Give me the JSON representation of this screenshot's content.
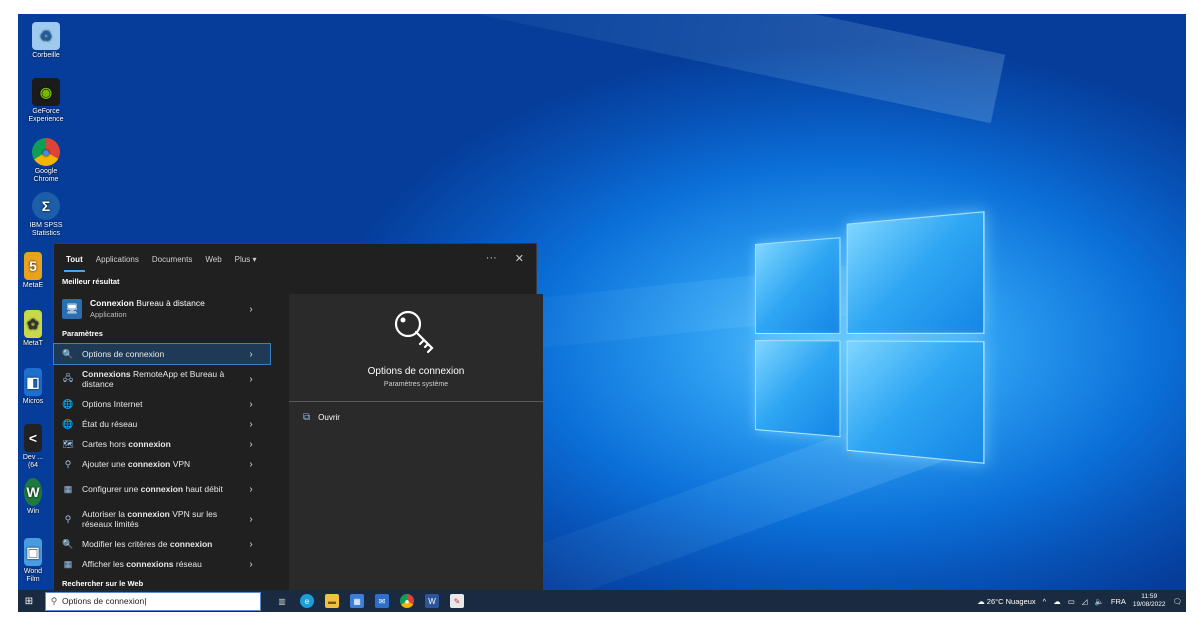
{
  "desktop": {
    "icons": [
      {
        "label": "Corbeille",
        "name": "recycle-bin-icon"
      },
      {
        "label": "GeForce Experience",
        "name": "geforce-icon"
      },
      {
        "label": "Google Chrome",
        "name": "chrome-icon"
      },
      {
        "label": "IBM SPSS Statistics",
        "name": "spss-icon"
      },
      {
        "label": "MetaE",
        "name": "meta-icon"
      },
      {
        "label": "MetaT",
        "name": "metat-icon"
      },
      {
        "label": "Micros",
        "name": "microsoft-icon"
      },
      {
        "label": "Dev ... (64",
        "name": "dev-icon"
      },
      {
        "label": "Win",
        "name": "win-icon"
      },
      {
        "label": "Wond Film",
        "name": "filmora-icon"
      }
    ]
  },
  "search": {
    "tabs": [
      "Tout",
      "Applications",
      "Documents",
      "Web",
      "Plus"
    ],
    "more_icon": "···",
    "close_icon": "✕",
    "best_match_header": "Meilleur résultat",
    "best_match": {
      "title_bold": "Connexion",
      "title_rest": " Bureau à distance",
      "subtitle": "Application"
    },
    "settings_header": "Paramètres",
    "items": [
      {
        "pre": "",
        "bold": "",
        "post": "Options de connexion",
        "icon": "🔍"
      },
      {
        "pre": "",
        "bold": "Connexions",
        "post": " RemoteApp et Bureau à distance",
        "icon": "🖧"
      },
      {
        "pre": "",
        "bold": "",
        "post": "Options Internet",
        "icon": "🌐"
      },
      {
        "pre": "",
        "bold": "",
        "post": "État du réseau",
        "icon": "🌐"
      },
      {
        "pre": "Cartes hors ",
        "bold": "connexion",
        "post": "",
        "icon": "🗺"
      },
      {
        "pre": "Ajouter une ",
        "bold": "connexion",
        "post": " VPN",
        "icon": "⚲"
      },
      {
        "pre": "Configurer une ",
        "bold": "connexion",
        "post": " haut débit",
        "icon": "▦"
      },
      {
        "pre": "Autoriser la ",
        "bold": "connexion",
        "post": " VPN sur les réseaux limités",
        "icon": "⚲"
      },
      {
        "pre": "Modifier les critères de ",
        "bold": "connexion",
        "post": "",
        "icon": "🔍"
      },
      {
        "pre": "Afficher les ",
        "bold": "connexions",
        "post": " réseau",
        "icon": "▦"
      }
    ],
    "web_header": "Rechercher sur le Web",
    "preview": {
      "title": "Options de connexion",
      "subtitle": "Paramètres système",
      "open_label": "Ouvrir"
    }
  },
  "taskbar": {
    "search_value": "Options de connexion",
    "weather": "26°C  Nuageux",
    "lang": "FRA",
    "time": "11:59",
    "date": "19/08/2022"
  },
  "colors": {
    "accent": "#4aa3f8",
    "panel": "#202020",
    "taskbar": "#1a2a40"
  }
}
